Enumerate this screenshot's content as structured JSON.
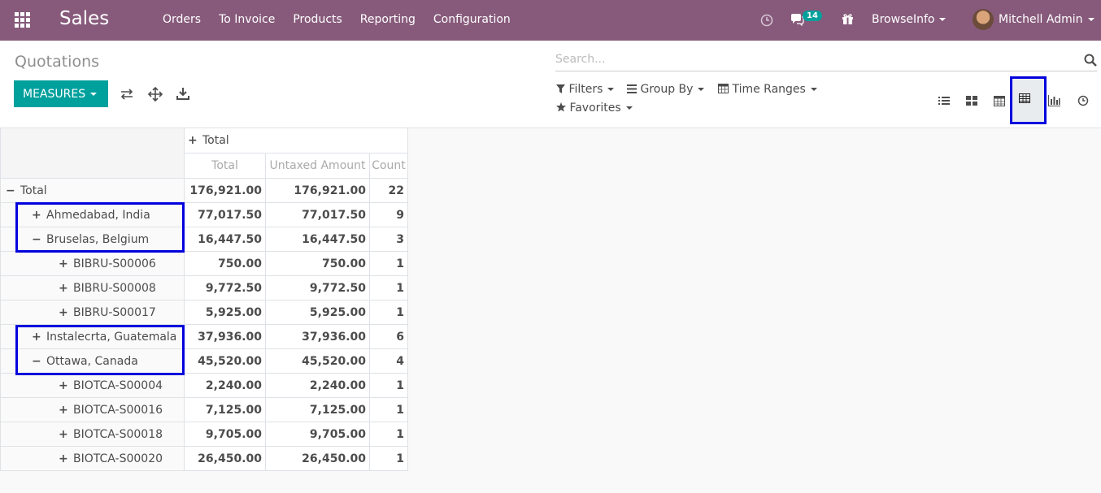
{
  "nav": {
    "brand": "Sales",
    "menu": [
      "Orders",
      "To Invoice",
      "Products",
      "Reporting",
      "Configuration"
    ],
    "messages_count": "14",
    "company": "BrowseInfo",
    "user": "Mitchell Admin"
  },
  "control": {
    "breadcrumb": "Quotations",
    "measures_label": "MEASURES",
    "search_placeholder": "Search...",
    "filters_label": "Filters",
    "groupby_label": "Group By",
    "timeranges_label": "Time Ranges",
    "favorites_label": "Favorites"
  },
  "pivot": {
    "col_group": "Total",
    "measures": [
      "Total",
      "Untaxed Amount",
      "Count"
    ],
    "rows": [
      {
        "label": "Total",
        "level": 0,
        "sign": "minus",
        "total": "176,921.00",
        "untaxed": "176,921.00",
        "count": "22"
      },
      {
        "label": "Ahmedabad, India",
        "level": 1,
        "sign": "plus",
        "total": "77,017.50",
        "untaxed": "77,017.50",
        "count": "9"
      },
      {
        "label": "Bruselas, Belgium",
        "level": 1,
        "sign": "minus",
        "total": "16,447.50",
        "untaxed": "16,447.50",
        "count": "3"
      },
      {
        "label": "BIBRU-S00006",
        "level": 2,
        "sign": "plus",
        "total": "750.00",
        "untaxed": "750.00",
        "count": "1"
      },
      {
        "label": "BIBRU-S00008",
        "level": 2,
        "sign": "plus",
        "total": "9,772.50",
        "untaxed": "9,772.50",
        "count": "1"
      },
      {
        "label": "BIBRU-S00017",
        "level": 2,
        "sign": "plus",
        "total": "5,925.00",
        "untaxed": "5,925.00",
        "count": "1"
      },
      {
        "label": "Instalecrta, Guatemala",
        "level": 1,
        "sign": "plus",
        "total": "37,936.00",
        "untaxed": "37,936.00",
        "count": "6"
      },
      {
        "label": "Ottawa, Canada",
        "level": 1,
        "sign": "minus",
        "total": "45,520.00",
        "untaxed": "45,520.00",
        "count": "4"
      },
      {
        "label": "BIOTCA-S00004",
        "level": 2,
        "sign": "plus",
        "total": "2,240.00",
        "untaxed": "2,240.00",
        "count": "1"
      },
      {
        "label": "BIOTCA-S00016",
        "level": 2,
        "sign": "plus",
        "total": "7,125.00",
        "untaxed": "7,125.00",
        "count": "1"
      },
      {
        "label": "BIOTCA-S00018",
        "level": 2,
        "sign": "plus",
        "total": "9,705.00",
        "untaxed": "9,705.00",
        "count": "1"
      },
      {
        "label": "BIOTCA-S00020",
        "level": 2,
        "sign": "plus",
        "total": "26,450.00",
        "untaxed": "26,450.00",
        "count": "1"
      }
    ]
  },
  "colors": {
    "topbar": "#875a7b",
    "accent": "#00a09d",
    "highlight": "#0000dd"
  }
}
